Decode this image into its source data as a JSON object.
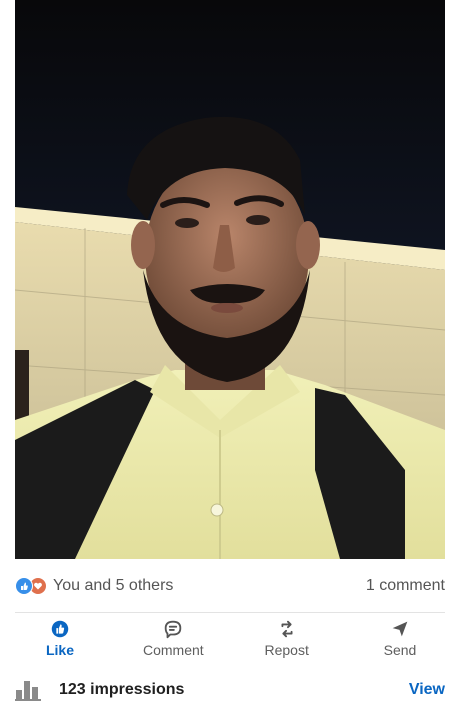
{
  "post": {
    "photo_icon": "selfie-photo"
  },
  "social": {
    "reactions_text": "You and 5 others",
    "comments_text": "1 comment",
    "reaction_icons": [
      "like-icon",
      "love-icon"
    ]
  },
  "actions": {
    "like": "Like",
    "comment": "Comment",
    "repost": "Repost",
    "send": "Send"
  },
  "impressions": {
    "text": "123 impressions",
    "view_label": "View"
  },
  "colors": {
    "accent": "#0a66c2",
    "like_badge": "#378fe9",
    "love_badge": "#df704d"
  }
}
